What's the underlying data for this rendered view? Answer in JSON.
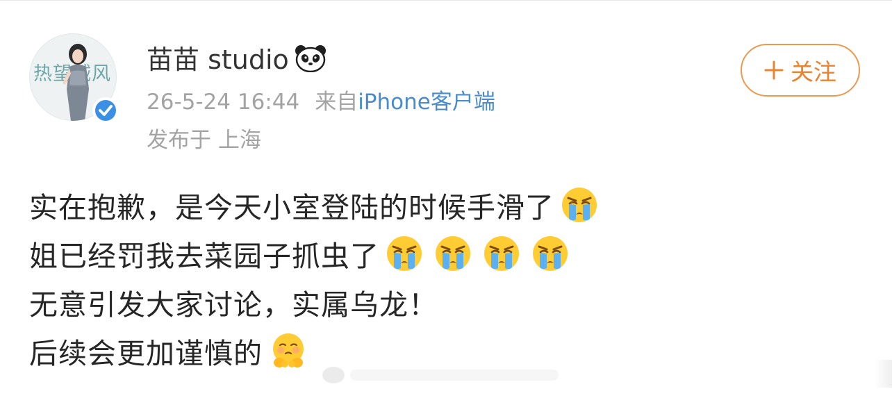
{
  "post": {
    "author": {
      "name": "苗苗 studio",
      "name_emoji": "panda-icon",
      "avatar_text": "热望诚风",
      "verified_badge": "verified-check-icon"
    },
    "timestamp": "26-5-24 16:44",
    "source_prefix": "来自",
    "source_device": "iPhone客户端",
    "location": "发布于 上海",
    "follow_button_label": "关注",
    "lines": [
      {
        "text": "实在抱歉，是今天小室登陆的时候手滑了",
        "emojis": [
          "crying-face-icon"
        ]
      },
      {
        "text": "姐已经罚我去菜园子抓虫了",
        "emojis": [
          "crying-face-icon",
          "crying-face-icon",
          "crying-face-icon",
          "crying-face-icon"
        ]
      },
      {
        "text": "无意引发大家讨论，实属乌龙！",
        "emojis": []
      },
      {
        "text": "后续会更加谨慎的",
        "emojis": [
          "embarrassed-face-icon"
        ]
      }
    ]
  },
  "colors": {
    "accent_orange": "#e8842e",
    "link_blue": "#4a8bc9",
    "meta_gray": "#a3a3a3",
    "verified_blue": "#3b8fe4",
    "emoji_yellow": "#ffcc33"
  }
}
